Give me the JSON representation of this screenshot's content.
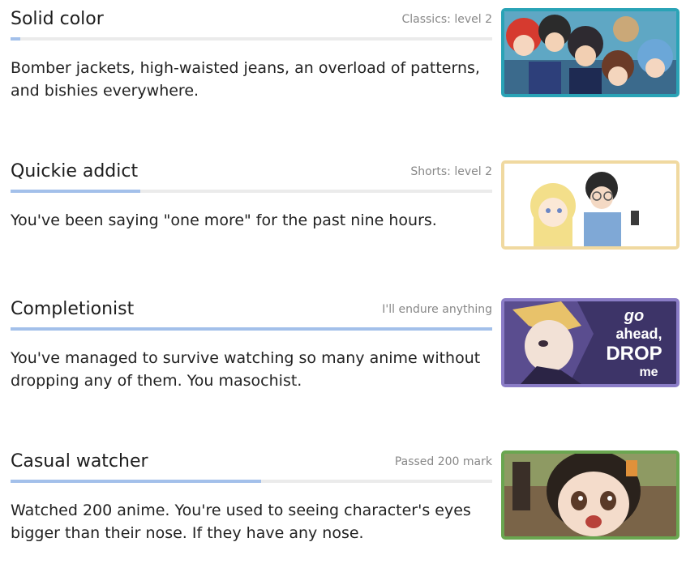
{
  "badges": [
    {
      "title": "Solid color",
      "level": "Classics: level 2",
      "description": "Bomber jackets, high-waisted jeans, an overload of patterns, and bishies everywhere.",
      "progress": 0.02,
      "thumb_border_color": "#2aa3b6",
      "image_text": []
    },
    {
      "title": "Quickie addict",
      "level": "Shorts: level 2",
      "description": "You've been saying \"one more\" for the past nine hours.",
      "progress": 0.27,
      "thumb_border_color": "#f0d9a0",
      "image_text": []
    },
    {
      "title": "Completionist",
      "level": "I'll endure anything",
      "description": "You've managed to survive watching so many anime without dropping any of them. You masochist.",
      "progress": 1.0,
      "thumb_border_color": "#8a7cc6",
      "image_text": [
        "go",
        "ahead,",
        "DROP",
        "me"
      ]
    },
    {
      "title": "Casual watcher",
      "level": "Passed 200 mark",
      "description": "Watched 200 anime. You're used to seeing character's eyes bigger than their nose. If they have any nose.",
      "progress": 0.52,
      "thumb_border_color": "#6aa650",
      "image_text": []
    }
  ]
}
